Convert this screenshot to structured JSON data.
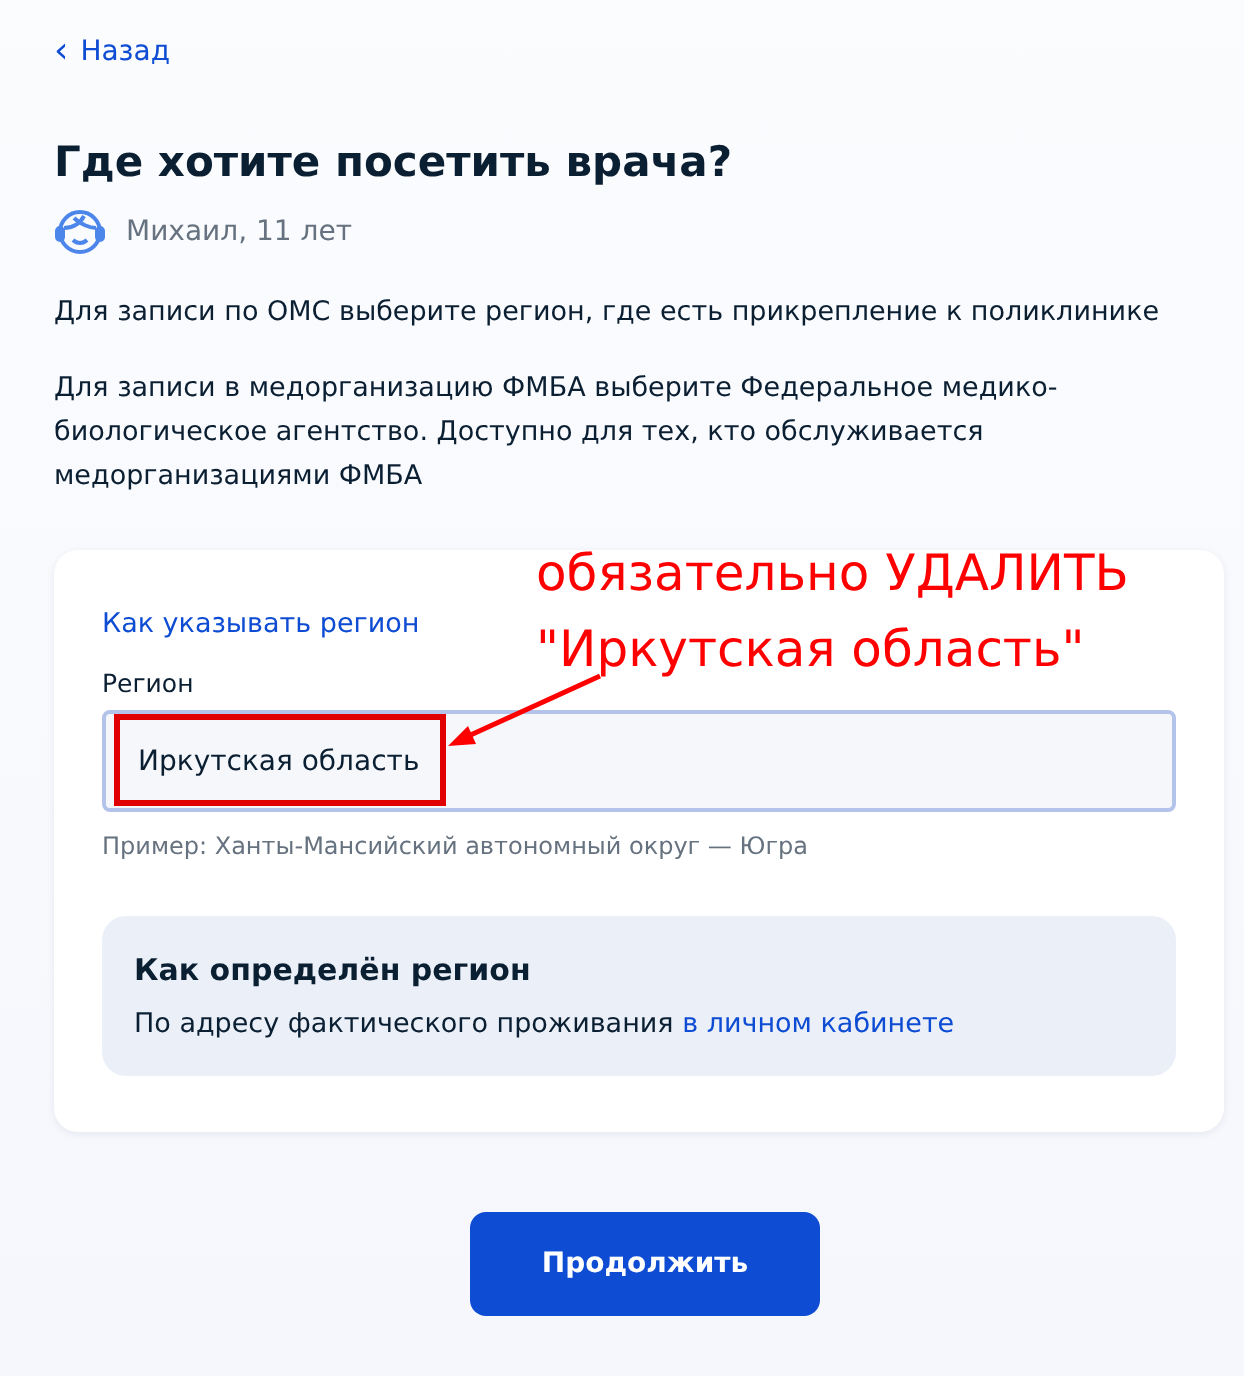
{
  "back_link": {
    "icon": "‹",
    "label": "Назад"
  },
  "title": "Где хотите посетить врача?",
  "patient": "Михаил, 11 лет",
  "paragraphs": [
    "Для записи по ОМС выберите регион, где есть прикрепление к поликлинике",
    "Для записи в медорганизацию ФМБА выберите Федеральное медико-биологическое агентство. Доступно для тех, кто обслуживается медорганизациями ФМБА"
  ],
  "card": {
    "help_link": "Как указывать регион",
    "field": {
      "label": "Регион",
      "value": "Иркутская область",
      "hint": "Пример: Ханты-Мансийский автономный округ — Югра"
    },
    "info": {
      "title": "Как определён регион",
      "text": "По адресу фактического проживания",
      "link": "в личном кабинете"
    }
  },
  "annotation": {
    "lines": [
      "обязательно УДАЛИТЬ",
      "\"Иркутская область\""
    ]
  },
  "button": "Продолжить"
}
